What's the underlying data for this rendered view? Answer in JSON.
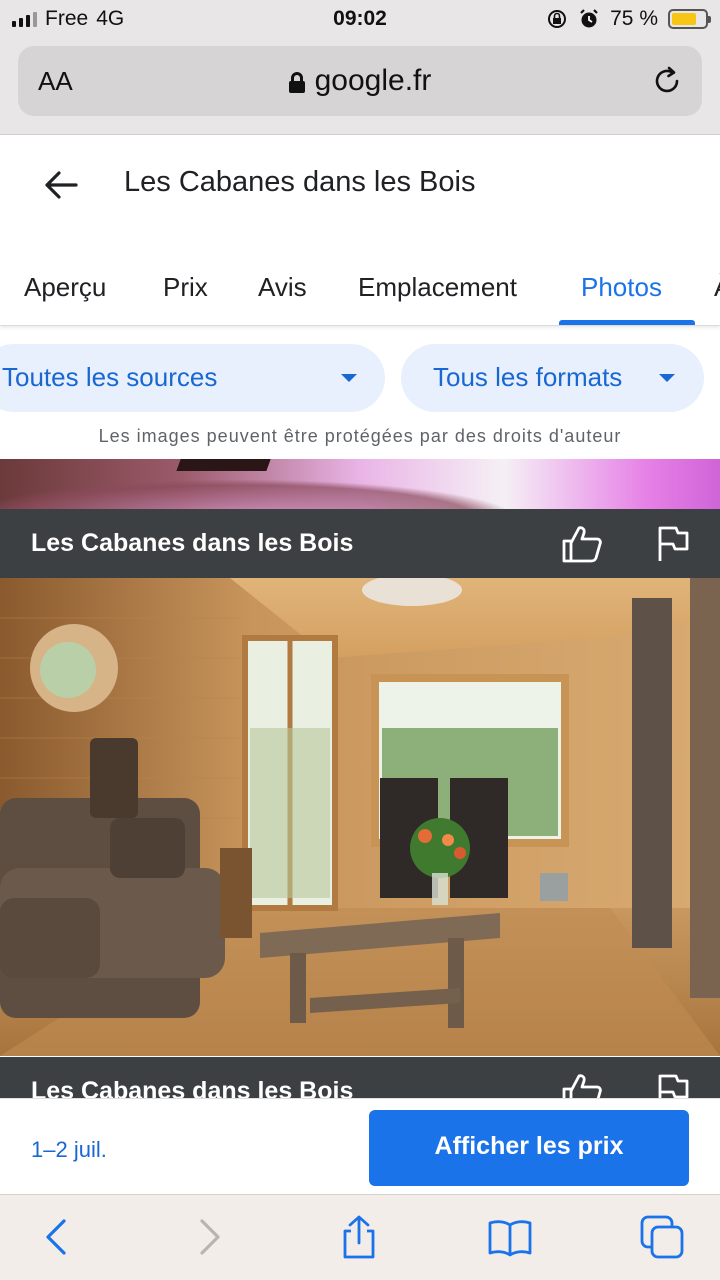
{
  "status_bar": {
    "carrier": "Free",
    "network": "4G",
    "time": "09:02",
    "battery": "75 %",
    "battery_level": 0.75
  },
  "browser": {
    "text_size_label": "AA",
    "host": "google.fr"
  },
  "header": {
    "title": "Les Cabanes dans les Bois"
  },
  "tabs": [
    {
      "label": "Aperçu",
      "active": false
    },
    {
      "label": "Prix",
      "active": false
    },
    {
      "label": "Avis",
      "active": false
    },
    {
      "label": "Emplacement",
      "active": false
    },
    {
      "label": "Photos",
      "active": true
    },
    {
      "label": "À",
      "active": false
    }
  ],
  "filters": {
    "source": "Toutes les sources",
    "format": "Tous les formats"
  },
  "copyright_note": "Les images peuvent être protégées par des droits d'auteur",
  "photos": [
    {
      "caption": "Les Cabanes dans les Bois"
    },
    {
      "caption": "Les Cabanes dans les Bois"
    }
  ],
  "booking": {
    "dates": "1–2 juil.",
    "button_label": "Afficher les prix"
  },
  "colors": {
    "accent": "#1a73e8",
    "chip_bg": "#e8f0fe",
    "caption_bg": "#3c4043",
    "battery": "#f6c515"
  }
}
